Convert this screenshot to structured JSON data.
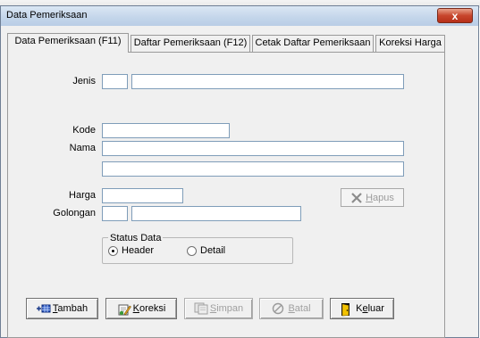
{
  "window": {
    "title": "Data Pemeriksaan",
    "close_glyph": "x"
  },
  "tabs": [
    {
      "label": "Data Pemeriksaan (F11)",
      "active": true
    },
    {
      "label": "Daftar Pemeriksaan (F12)",
      "active": false
    },
    {
      "label": "Cetak Daftar Pemeriksaan",
      "active": false
    },
    {
      "label": "Koreksi Harga",
      "active": false
    }
  ],
  "form": {
    "jenis_label": "Jenis",
    "kode_label": "Kode",
    "nama_label": "Nama",
    "harga_label": "Harga",
    "golongan_label": "Golongan",
    "jenis_code": "",
    "jenis_name": "",
    "kode": "",
    "nama1": "",
    "nama2": "",
    "harga": "",
    "golongan_code": "",
    "golongan_name": ""
  },
  "hapus": {
    "mnemonic": "H",
    "rest": "apus"
  },
  "status": {
    "legend": "Status Data",
    "options": [
      {
        "label": "Header",
        "selected": true
      },
      {
        "label": "Detail",
        "selected": false
      }
    ]
  },
  "buttons": {
    "tambah": {
      "mnemonic": "T",
      "rest": "ambah"
    },
    "koreksi": {
      "mnemonic": "K",
      "rest": "oreksi"
    },
    "simpan": {
      "mnemonic": "S",
      "rest": "impan"
    },
    "batal": {
      "mnemonic": "B",
      "rest": "atal"
    },
    "keluar": {
      "pre": "K",
      "mnemonic": "e",
      "rest": "luar"
    }
  }
}
